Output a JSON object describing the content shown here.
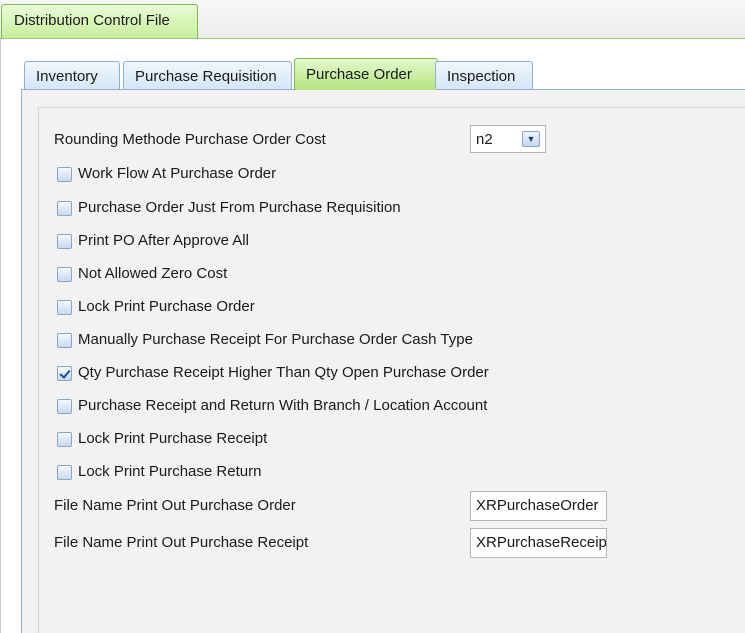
{
  "window": {
    "doc_tab": "Distribution Control File"
  },
  "tabs": [
    "Inventory",
    "Purchase Requisition",
    "Purchase Order",
    "Inspection"
  ],
  "rounding": {
    "label": "Rounding Methode Purchase Order Cost",
    "value": "n2"
  },
  "options": [
    {
      "label": "Work Flow At Purchase Order",
      "checked": false
    },
    {
      "label": "Purchase Order Just From Purchase Requisition",
      "checked": false
    },
    {
      "label": "Print PO After Approve All",
      "checked": false
    },
    {
      "label": "Not Allowed Zero Cost",
      "checked": false
    },
    {
      "label": "Lock Print Purchase Order",
      "checked": false
    },
    {
      "label": "Manually Purchase Receipt For Purchase Order Cash Type",
      "checked": false
    },
    {
      "label": "Qty Purchase Receipt Higher Than Qty Open Purchase Order",
      "checked": true
    },
    {
      "label": "Purchase Receipt and Return With Branch / Location Account",
      "checked": false
    },
    {
      "label": "Lock Print Purchase Receipt",
      "checked": false
    },
    {
      "label": "Lock Print Purchase Return",
      "checked": false
    }
  ],
  "files": [
    {
      "label": "File Name Print Out Purchase Order",
      "value": "XRPurchaseOrder"
    },
    {
      "label": "File Name Print Out Purchase Receipt",
      "value": "XRPurchaseReceipt"
    }
  ],
  "icons": {
    "dropdown": "chevron-down-icon",
    "checkbox_checked": "checkmark-icon"
  },
  "colors": {
    "active_tab": "#b6e57f",
    "inactive_tab": "#d6e6f7",
    "panel_bg": "#f2f2f2"
  }
}
